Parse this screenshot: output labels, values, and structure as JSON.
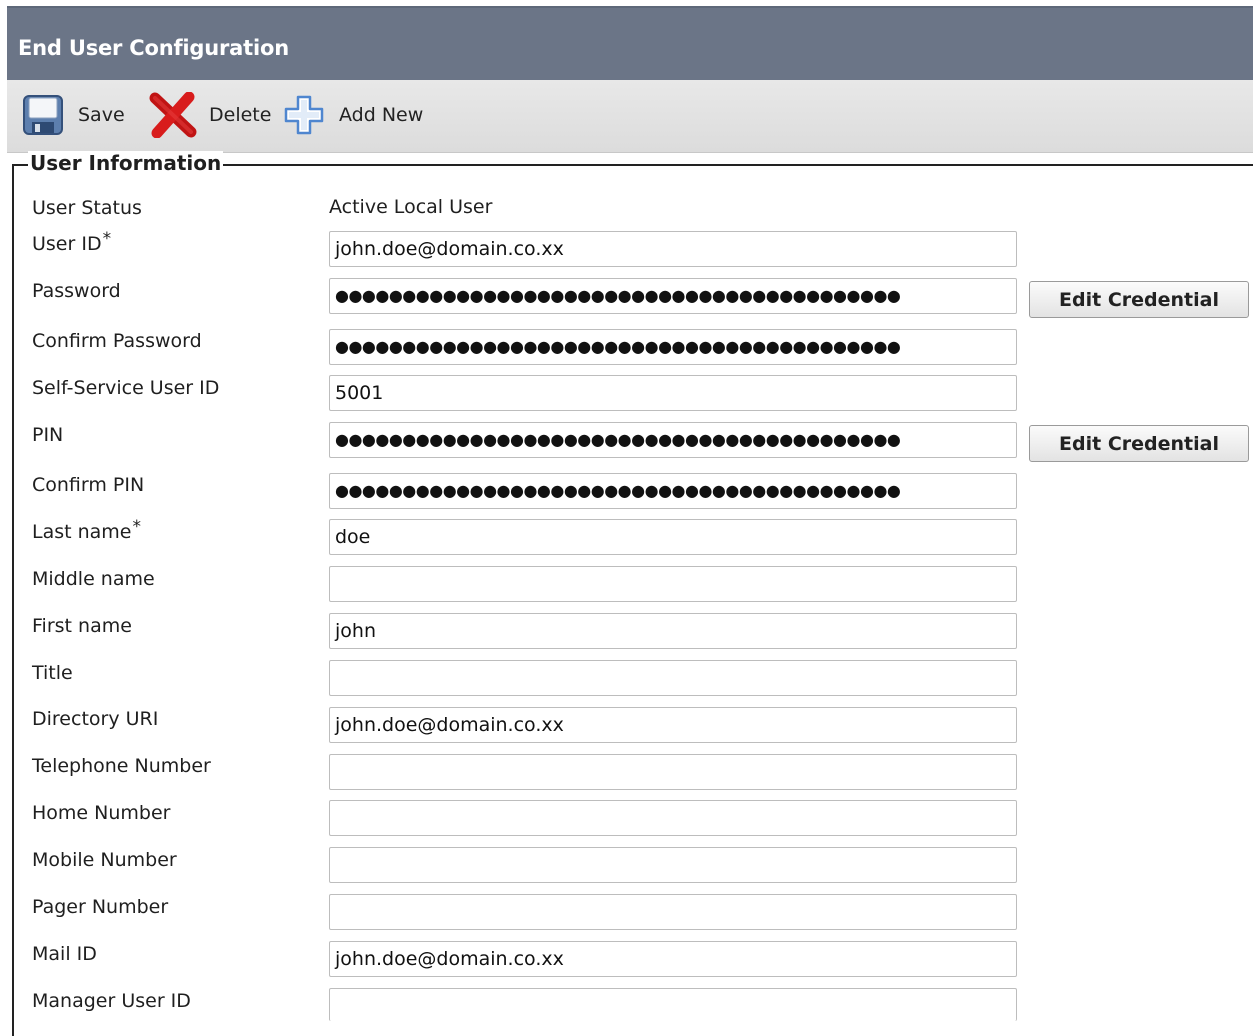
{
  "header": {
    "title": "End User Configuration"
  },
  "toolbar": {
    "save_label": "Save",
    "delete_label": "Delete",
    "add_new_label": "Add New",
    "icons": {
      "save": "floppy-disk-icon",
      "delete": "red-x-icon",
      "add": "plus-icon"
    }
  },
  "section": {
    "title": "User Information"
  },
  "user_status": {
    "label": "User Status",
    "value": "Active Local User"
  },
  "fields": {
    "user_id": {
      "label": "User ID",
      "required": "*",
      "value": "john.doe@domain.co.xx"
    },
    "password": {
      "label": "Password",
      "value": "●●●●●●●●●●●●●●●●●●●●●●●●●●●●●●●●●●●●●●●●●●"
    },
    "confirm_password": {
      "label": "Confirm Password",
      "value": "●●●●●●●●●●●●●●●●●●●●●●●●●●●●●●●●●●●●●●●●●●"
    },
    "self_service_user_id": {
      "label": "Self-Service User ID",
      "value": "5001"
    },
    "pin": {
      "label": "PIN",
      "value": "●●●●●●●●●●●●●●●●●●●●●●●●●●●●●●●●●●●●●●●●●●"
    },
    "confirm_pin": {
      "label": "Confirm PIN",
      "value": "●●●●●●●●●●●●●●●●●●●●●●●●●●●●●●●●●●●●●●●●●●"
    },
    "last_name": {
      "label": "Last name",
      "required": "*",
      "value": "doe"
    },
    "middle_name": {
      "label": "Middle name",
      "value": ""
    },
    "first_name": {
      "label": "First name",
      "value": "john"
    },
    "title": {
      "label": "Title",
      "value": ""
    },
    "directory_uri": {
      "label": "Directory URI",
      "value": "john.doe@domain.co.xx"
    },
    "telephone_number": {
      "label": "Telephone Number",
      "value": ""
    },
    "home_number": {
      "label": "Home Number",
      "value": ""
    },
    "mobile_number": {
      "label": "Mobile Number",
      "value": ""
    },
    "pager_number": {
      "label": "Pager Number",
      "value": ""
    },
    "mail_id": {
      "label": "Mail ID",
      "value": "john.doe@domain.co.xx"
    },
    "manager_user_id": {
      "label": "Manager User ID",
      "value": ""
    }
  },
  "buttons": {
    "edit_credential_password": "Edit Credential",
    "edit_credential_pin": "Edit Credential"
  },
  "colors": {
    "header_bg": "#6b7587",
    "toolbar_bg": "#e0e0e0",
    "delete_red": "#d41a1a",
    "add_blue": "#5b8fd6"
  }
}
